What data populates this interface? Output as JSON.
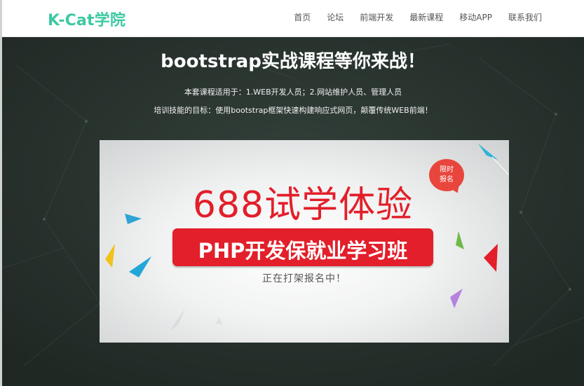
{
  "navbar": {
    "brand": "K-Cat学院",
    "items": [
      {
        "label": "首页"
      },
      {
        "label": "论坛"
      },
      {
        "label": "前端开发"
      },
      {
        "label": "最新课程"
      },
      {
        "label": "移动APP"
      },
      {
        "label": "联系我们"
      }
    ]
  },
  "hero": {
    "title": "bootstrap实战课程等你来战！",
    "line1": "本套课程适用于：1.WEB开发人员；2.网站维护人员、管理人员",
    "line2": "培训技能的目标：使用bootstrap框架快速构建响应式网页，颠覆传统WEB前端！"
  },
  "banner": {
    "badge_top": "限时",
    "badge_bottom": "报名",
    "headline": "688试学体验",
    "bar_text": "PHP开发保就业学习班",
    "subtext": "正在打架报名中！"
  },
  "colors": {
    "brand": "#3dc9a3",
    "hero_bg": "#28312d",
    "banner_red": "#e21f2a"
  }
}
